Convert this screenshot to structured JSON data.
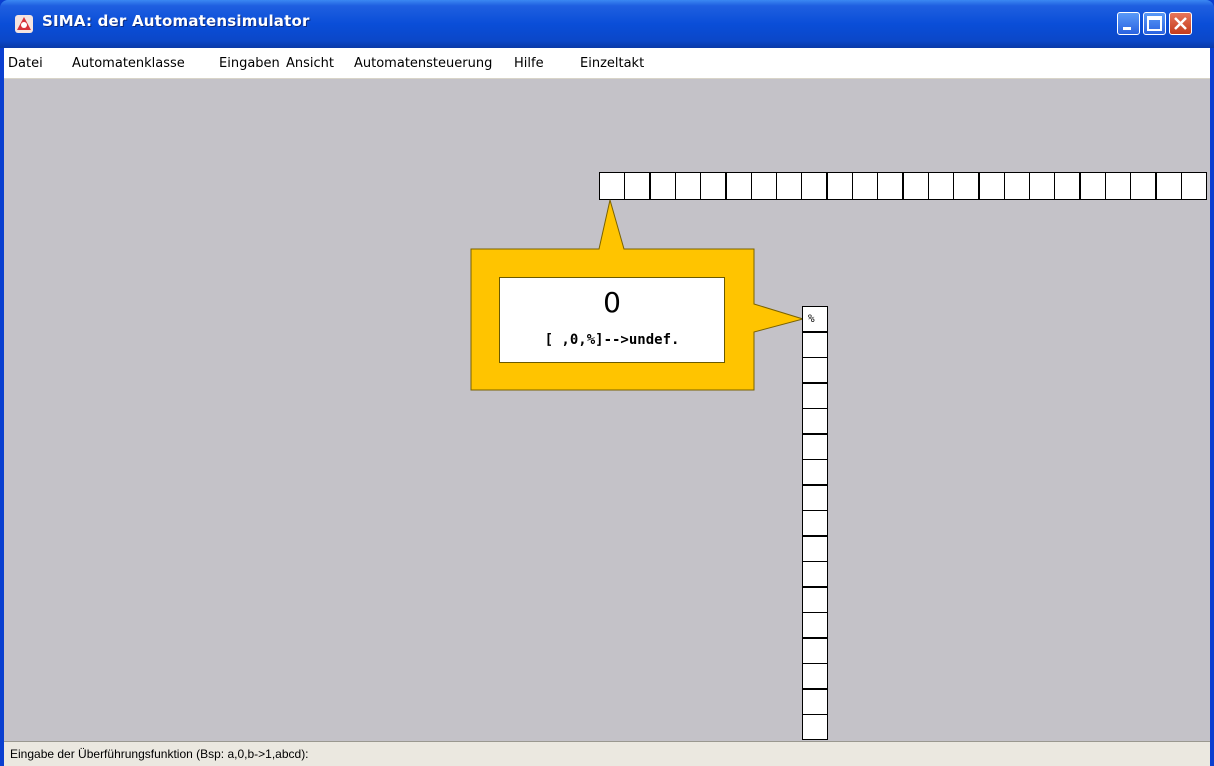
{
  "window": {
    "title": "SIMA: der Automatensimulator",
    "controls": [
      "minimize",
      "maximize",
      "close"
    ]
  },
  "menu": {
    "items": [
      "Datei",
      "Automatenklasse",
      "Eingaben",
      "Ansicht",
      "Automatensteuerung",
      "Hilfe",
      "Einzeltakt"
    ]
  },
  "tape": {
    "horizontal_cell_count": 24,
    "vertical_cell_count": 17,
    "vertical_top_symbol": "%"
  },
  "state_box": {
    "state": "0",
    "transition": "[ ,0,%]-->undef.",
    "color": "#ffc400"
  },
  "status": {
    "text": "Eingabe der Überführungsfunktion (Bsp: a,0,b->1,abcd):"
  }
}
